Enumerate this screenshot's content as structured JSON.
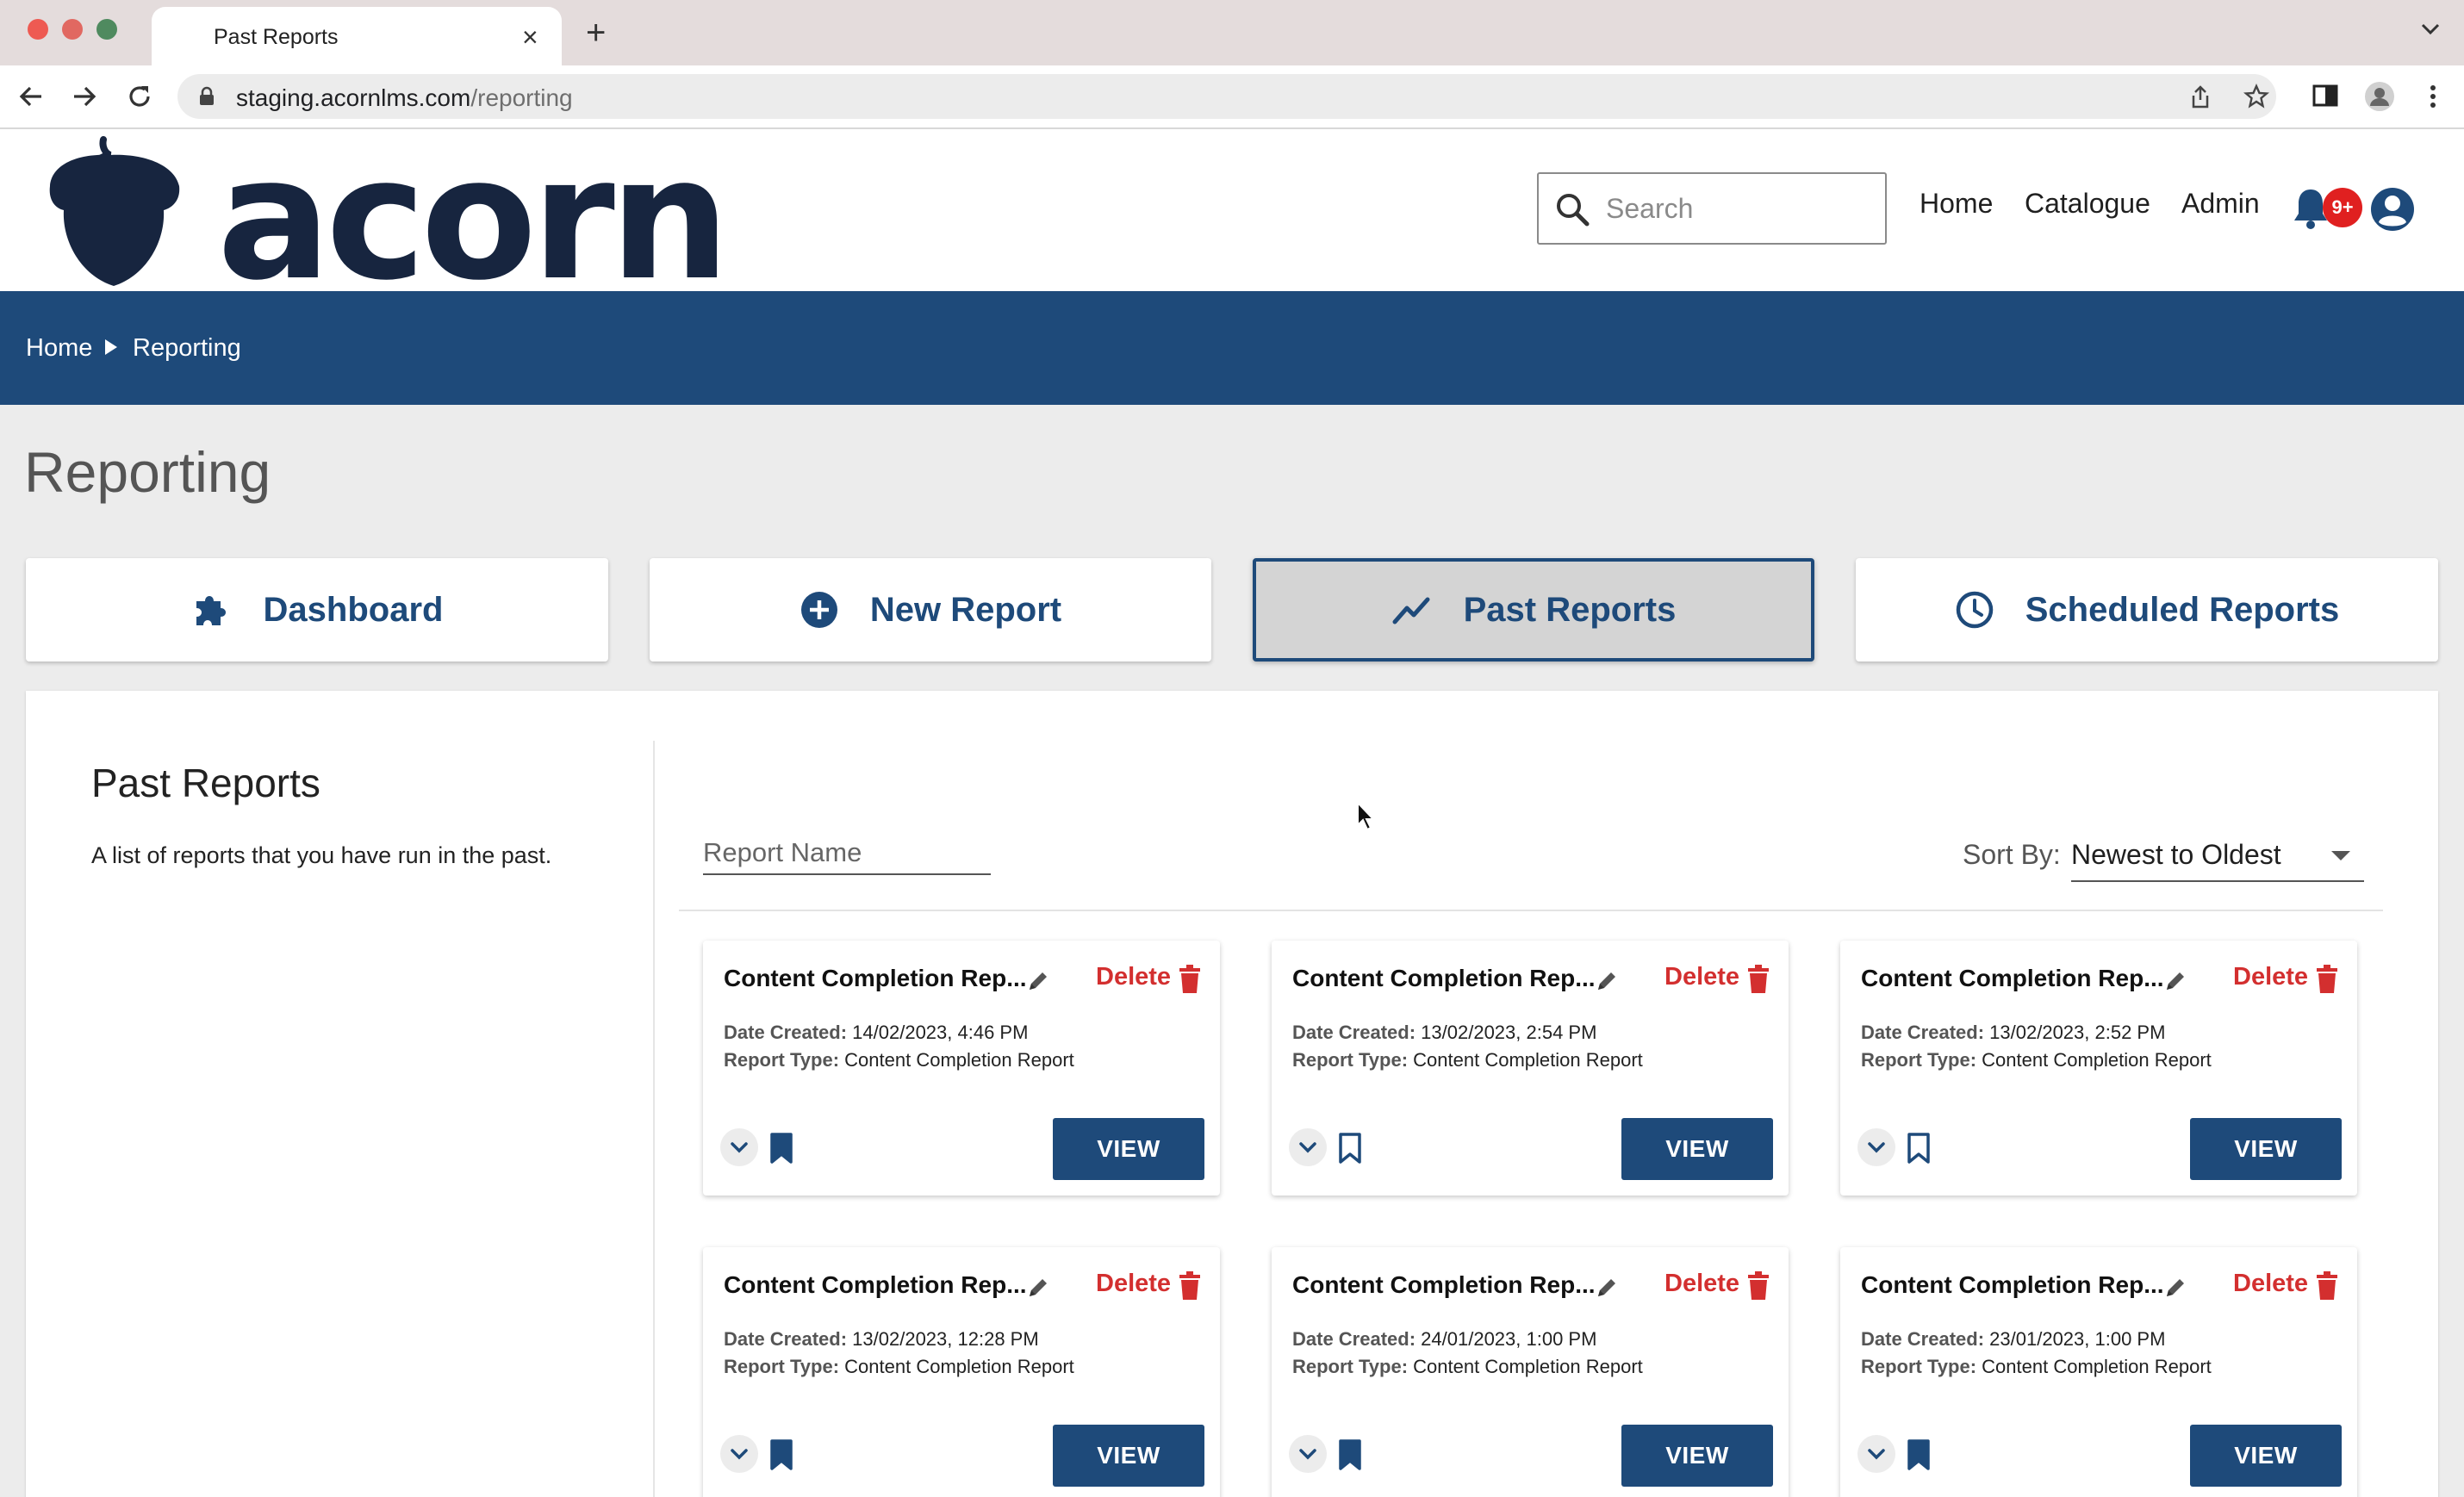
{
  "browser": {
    "tab_title": "Past Reports",
    "url_domain": "staging.acornlms.com",
    "url_path": "/reporting"
  },
  "header": {
    "logo_text": "acorn",
    "search_placeholder": "Search",
    "nav_links": [
      "Home",
      "Catalogue",
      "Admin"
    ],
    "notification_badge": "9+"
  },
  "breadcrumb": [
    "Home",
    "Reporting"
  ],
  "page": {
    "title": "Reporting",
    "nav_cards": [
      {
        "label": "Dashboard",
        "icon": "puzzle-icon"
      },
      {
        "label": "New Report",
        "icon": "plus-circle-icon"
      },
      {
        "label": "Past Reports",
        "icon": "trend-line-icon",
        "active": true
      },
      {
        "label": "Scheduled Reports",
        "icon": "clock-icon"
      }
    ]
  },
  "panel": {
    "title": "Past Reports",
    "description": "A list of reports that you have run in the past.",
    "filter_placeholder": "Report Name",
    "sort_label": "Sort By:",
    "sort_value": "Newest to Oldest"
  },
  "card_labels": {
    "delete": "Delete",
    "date_created": "Date Created:",
    "report_type": "Report Type:",
    "view": "VIEW"
  },
  "reports": [
    {
      "name": "Content Completion Rep...",
      "date_created": "14/02/2023, 4:46 PM",
      "report_type": "Content Completion Report",
      "bookmarked": true
    },
    {
      "name": "Content Completion Rep...",
      "date_created": "13/02/2023, 2:54 PM",
      "report_type": "Content Completion Report",
      "bookmarked": false
    },
    {
      "name": "Content Completion Rep...",
      "date_created": "13/02/2023, 2:52 PM",
      "report_type": "Content Completion Report",
      "bookmarked": false
    },
    {
      "name": "Content Completion Rep...",
      "date_created": "13/02/2023, 12:28 PM",
      "report_type": "Content Completion Report",
      "bookmarked": true
    },
    {
      "name": "Content Completion Rep...",
      "date_created": "24/01/2023, 1:00 PM",
      "report_type": "Content Completion Report",
      "bookmarked": true
    },
    {
      "name": "Content Completion Rep...",
      "date_created": "23/01/2023, 1:00 PM",
      "report_type": "Content Completion Report",
      "bookmarked": true
    }
  ],
  "colors": {
    "brand_navy": "#1e4a7a",
    "delete_red": "#d32f2f",
    "badge_red": "#e02020"
  }
}
